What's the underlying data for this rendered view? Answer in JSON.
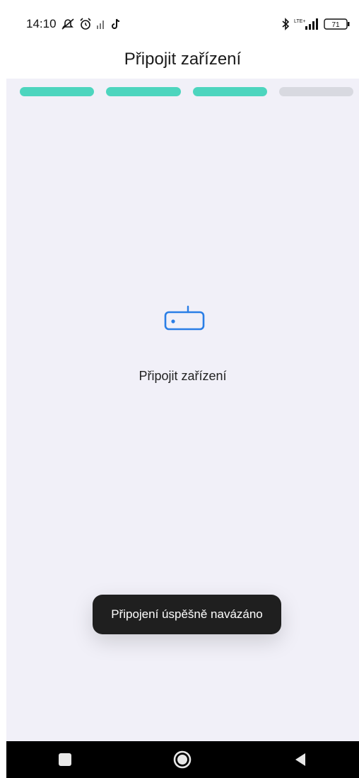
{
  "status": {
    "time": "14:10",
    "battery": "71",
    "network": "LTE+",
    "icons_left": [
      "notifications-muted-icon",
      "alarm-icon",
      "signal-icon",
      "tiktok-icon"
    ],
    "icons_right": [
      "bluetooth-icon",
      "signal-bars-icon",
      "battery-icon"
    ]
  },
  "header": {
    "title": "Připojit zařízení"
  },
  "progress": {
    "steps_total": 4,
    "steps_completed": 3,
    "active_color": "#4dd5be",
    "inactive_color": "#d8d9e0"
  },
  "main": {
    "icon": "router-device-icon",
    "label": "Připojit zařízení"
  },
  "toast": {
    "message": "Připojení úspěšně navázáno"
  },
  "navigation": {
    "buttons": [
      "recent-apps-button",
      "home-button",
      "back-button"
    ]
  }
}
